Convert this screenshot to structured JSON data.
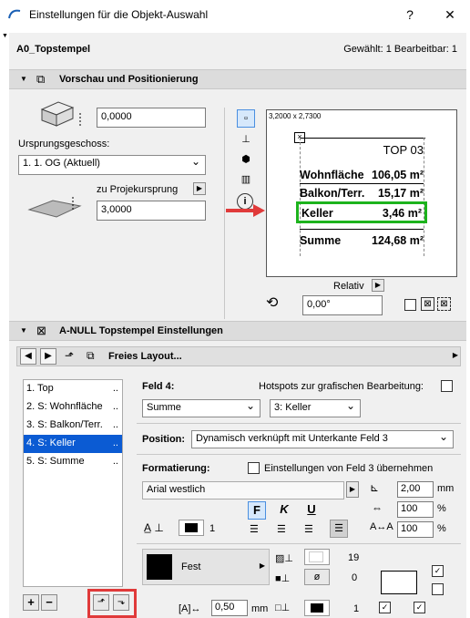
{
  "window": {
    "title": "Einstellungen für die Objekt-Auswahl",
    "help": "?",
    "close": "✕"
  },
  "header": {
    "object_name": "A0_Topstempel",
    "selection_info": "Gewählt: 1 Bearbeitbar: 1"
  },
  "section_preview": {
    "title": "Vorschau und Positionierung",
    "elevation_value": "0,0000",
    "origin_story_label": "Ursprungsgeschoss:",
    "origin_story_value": "1. 1. OG (Aktuell)",
    "project_origin_label": "zu Projekursprung",
    "project_origin_value": "3,0000",
    "relative_label": "Relativ",
    "angle_value": "0,00°"
  },
  "preview": {
    "size": "3,2000 x 2,7300",
    "top_label": "TOP 03",
    "rows": [
      {
        "label": "Wohnfläche",
        "value": "106,05 m²"
      },
      {
        "label": "Balkon/Terr.",
        "value": "15,17 m²"
      },
      {
        "label": "Keller",
        "value": "3,46 m²"
      },
      {
        "label": "Summe",
        "value": "124,68 m²"
      }
    ],
    "highlight_color": "#1db31d",
    "arrow_color": "#e03a3a"
  },
  "section_settings": {
    "title": "A-NULL Topstempel Einstellungen",
    "layout_label": "Freies Layout..."
  },
  "fields_list": [
    {
      "label": "1. Top",
      "suffix": ".."
    },
    {
      "label": "2. S: Wohnfläche",
      "suffix": ".."
    },
    {
      "label": "3. S: Balkon/Terr.",
      "suffix": ".."
    },
    {
      "label": "4. S: Keller",
      "suffix": ".."
    },
    {
      "label": "5. S: Summe",
      "suffix": ".."
    }
  ],
  "field_detail": {
    "field_label": "Feld 4:",
    "hotspots_label": "Hotspots zur grafischen Bearbeitung:",
    "type_value": "Summe",
    "source_value": "3: Keller",
    "position_label": "Position:",
    "position_value": "Dynamisch verknüpft mit Unterkante Feld 3",
    "format_label": "Formatierung:",
    "inherit_label": "Einstellungen von Feld 3 übernehmen",
    "font_value": "Arial westlich",
    "bold": "F",
    "italic": "K",
    "underline": "U",
    "size_value": "2,00",
    "size_unit": "mm",
    "width_value": "100",
    "width_unit": "%",
    "spacing_value": "100",
    "spacing_unit": "%",
    "pen_value": "1",
    "fill_label": "Fest",
    "fill_pen": "19",
    "bg_pen": "0",
    "frame_offset_value": "0,50",
    "frame_offset_unit": "mm",
    "frame_pen": "1"
  }
}
